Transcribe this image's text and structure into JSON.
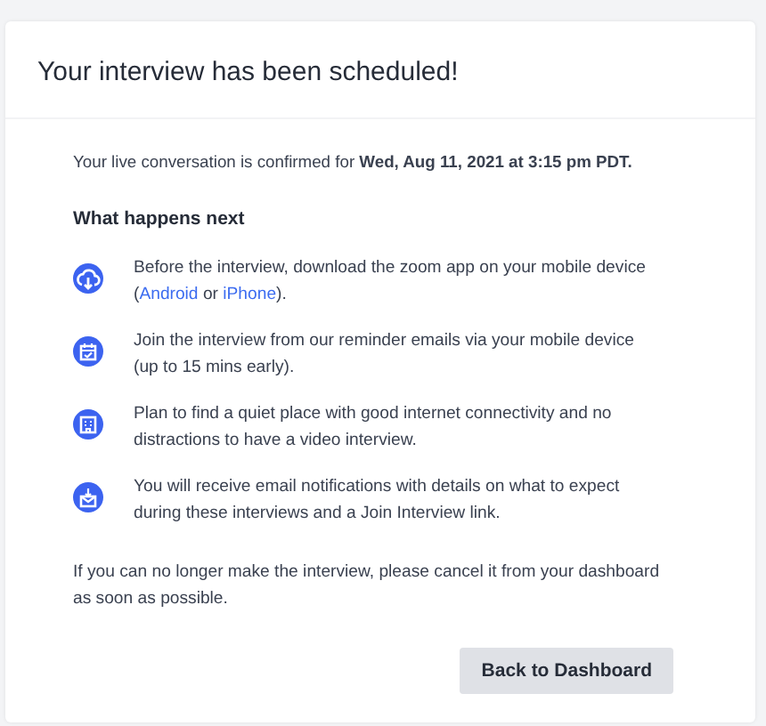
{
  "dialog": {
    "title": "Your interview has been scheduled!"
  },
  "confirmation": "Your live conversation is confirmed for **Wed, Aug 11, 2021 at 3:15 pm PDT.**",
  "next_heading": "What happens next",
  "steps": [
    {
      "kind": "download",
      "text": [
        {
          "kind": "plain",
          "text": "Before the interview, download the zoom app on your mobile device ("
        },
        {
          "kind": "link",
          "text": "Android"
        },
        {
          "kind": "plain",
          "text": " or "
        },
        {
          "kind": "link",
          "text": "iPhone"
        },
        {
          "kind": "plain",
          "text": ")."
        }
      ]
    },
    {
      "kind": "calendar",
      "text": [
        {
          "kind": "plain",
          "text": "Join the interview from our reminder emails via your mobile device (up to 15 mins early)."
        }
      ]
    },
    {
      "kind": "building",
      "text": [
        {
          "kind": "plain",
          "text": "Plan to find a quiet place with good internet connectivity and no distractions to have a video interview."
        }
      ]
    },
    {
      "kind": "mail",
      "text": [
        {
          "kind": "plain",
          "text": "You will receive email notifications with details on what to expect during these interviews and a Join Interview link."
        }
      ]
    }
  ],
  "cancel_note": "If you can no longer make the interview, please cancel it from your dashboard as soon as possible.",
  "button": "Back to Dashboard"
}
